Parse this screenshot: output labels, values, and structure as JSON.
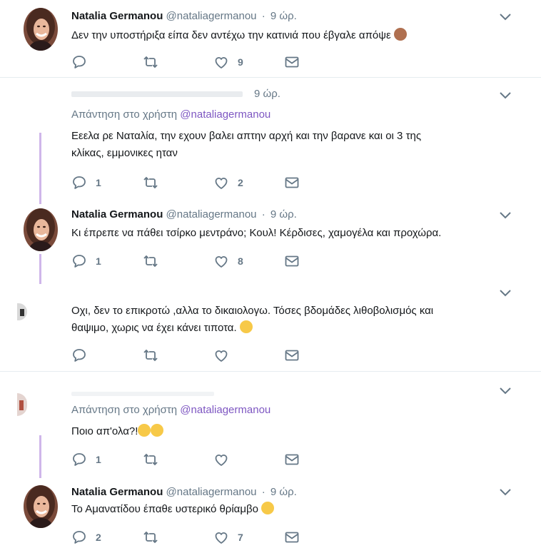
{
  "tweets": [
    {
      "name": "Natalia Germanou",
      "handle": "@nataliagermanou",
      "time": "9 ώρ.",
      "text": "Δεν την υποστήριξα είπα δεν αντέχω την κατινιά που έβγαλε απόψε",
      "emoji": "see-no-evil-monkey",
      "replies": "",
      "retweets": "",
      "likes": "9"
    },
    {
      "time": "9 ώρ.",
      "reply_prefix": "Απάντηση στο χρήστη",
      "reply_mention": "@nataliagermanou",
      "text_line1": "Εεελα ρε Ναταλία, την εχουν βαλει απτην αρχή και την βαρανε και οι 3 της",
      "text_line2": "κλίκας, εμμονικες ηταν",
      "replies": "1",
      "retweets": "",
      "likes": "2"
    },
    {
      "name": "Natalia Germanou",
      "handle": "@nataliagermanou",
      "time": "9 ώρ.",
      "text": "Κι έπρεπε να πάθει τσίρκο μεντράνο; Κουλ! Κέρδισες, χαμογέλα και προχώρα.",
      "replies": "1",
      "retweets": "",
      "likes": "8"
    },
    {
      "text_line1": "Οχι, δεν το επικροτώ ,αλλα το δικαιολογω. Τόσες βδομάδες λιθοβολισμός και",
      "text_line2": "θαψιμο, χωρις να έχει κάνει τιποτα.",
      "emoji": "face-savoring-food",
      "replies": "",
      "retweets": "",
      "likes": ""
    },
    {
      "reply_prefix": "Απάντηση στο χρήστη",
      "reply_mention": "@nataliagermanou",
      "text": "Ποιο απ'ολα?!",
      "emoji": "tears-of-joy x2",
      "replies": "1",
      "retweets": "",
      "likes": ""
    },
    {
      "name": "Natalia Germanou",
      "handle": "@nataliagermanou",
      "time": "9 ώρ.",
      "text": "Το Αμανατίδου έπαθε υστερικό θρίαμβο",
      "emoji": "tears-of-joy",
      "replies": "2",
      "retweets": "",
      "likes": "7"
    }
  ],
  "colors": {
    "mention": "#7e57c2",
    "thread_line": "#cfb6ea",
    "secondary_text": "#657786",
    "separator": "#e6ecf0"
  },
  "icons": [
    "reply-icon",
    "retweet-icon",
    "like-icon",
    "dm-icon",
    "chevron-down-icon"
  ]
}
